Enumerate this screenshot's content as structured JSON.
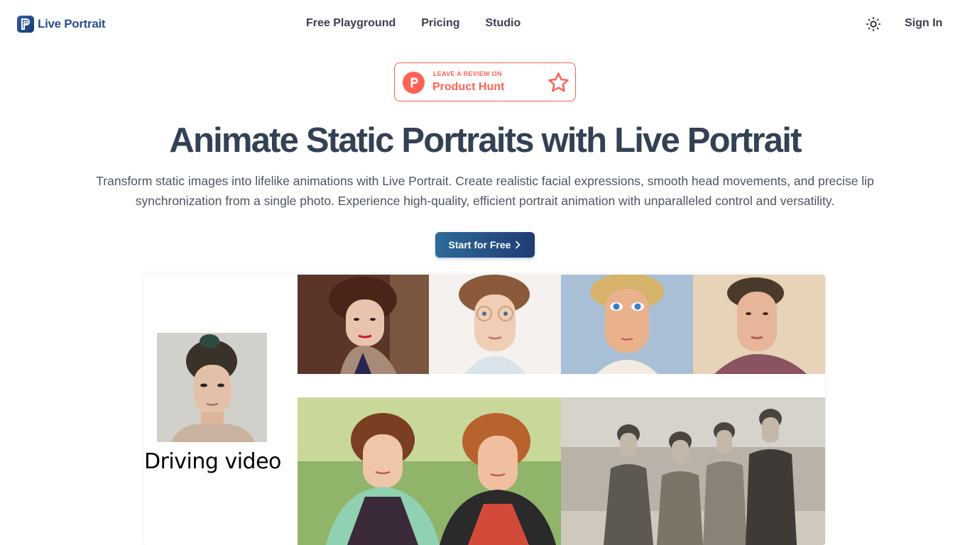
{
  "header": {
    "logo_text": "Live Portrait",
    "nav": [
      "Free Playground",
      "Pricing",
      "Studio"
    ],
    "sign_in": "Sign In"
  },
  "badge": {
    "small_text": "LEAVE A REVIEW ON",
    "big_text": "Product Hunt",
    "color": "#ff6154"
  },
  "hero": {
    "title": "Animate Static Portraits with Live Portrait",
    "subtitle": "Transform static images into lifelike animations with Live Portrait. Create realistic facial expressions, smooth head movements, and precise lip synchronization from a single photo. Experience high-quality, efficient portrait animation with unparalleled control and versatility.",
    "cta_label": "Start for Free"
  },
  "demo": {
    "driving_label": "Driving video"
  },
  "icons": {
    "theme": "sun-icon",
    "cta": "chevron-right-icon",
    "badge_star": "star-icon"
  }
}
